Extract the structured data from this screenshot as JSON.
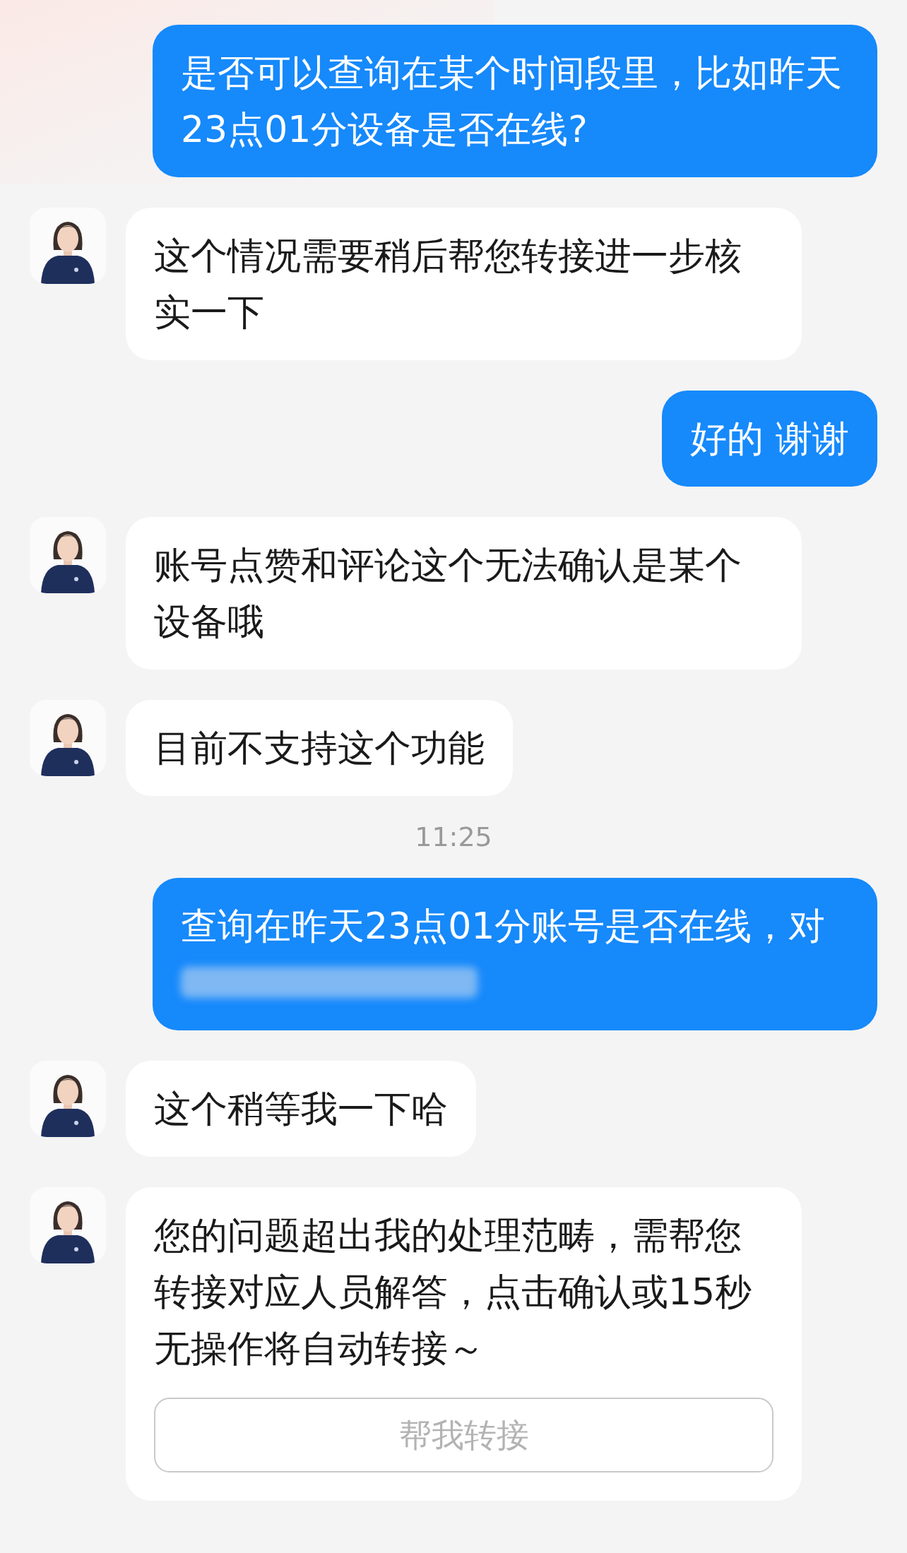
{
  "messages": [
    {
      "kind": "user",
      "text": "是否可以查询在某个时间段里，比如昨天23点01分设备是否在线?"
    },
    {
      "kind": "bot",
      "text": "这个情况需要稍后帮您转接进一步核实一下"
    },
    {
      "kind": "user",
      "text": "好的 谢谢"
    },
    {
      "kind": "bot",
      "text": "账号点赞和评论这个无法确认是某个设备哦"
    },
    {
      "kind": "bot",
      "text": "目前不支持这个功能"
    },
    {
      "kind": "time",
      "text": "11:25"
    },
    {
      "kind": "user",
      "text": "查询在昨天23点01分账号是否在线，对",
      "redacted": true
    },
    {
      "kind": "bot",
      "text": "这个稍等我一下哈"
    },
    {
      "kind": "bot",
      "text": "您的问题超出我的处理范畴，需帮您转接对应人员解答，点击确认或15秒无操作将自动转接～",
      "button": "帮我转接"
    }
  ]
}
